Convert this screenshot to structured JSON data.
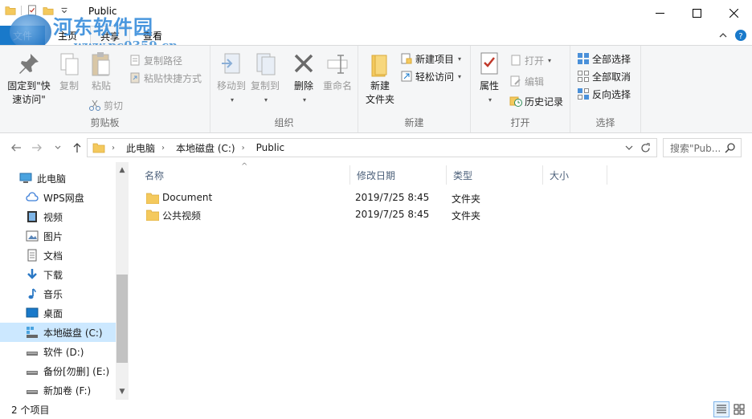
{
  "window": {
    "title": "Public"
  },
  "watermark": {
    "text": "河东软件园",
    "url": "www.pc0359.cn"
  },
  "tabs": [
    {
      "label": "文件"
    },
    {
      "label": "主页"
    },
    {
      "label": "共享"
    },
    {
      "label": "查看"
    }
  ],
  "ribbon": {
    "clipboard": {
      "label": "剪贴板",
      "pin": "固定到\"快",
      "pin2": "速访问\"",
      "copy": "复制",
      "paste": "粘贴",
      "copy_path": "复制路径",
      "paste_shortcut": "粘贴快捷方式",
      "cut": "剪切"
    },
    "organize": {
      "label": "组织",
      "move_to": "移动到",
      "copy_to": "复制到",
      "delete": "删除",
      "rename": "重命名"
    },
    "new": {
      "label": "新建",
      "new_folder_1": "新建",
      "new_folder_2": "文件夹",
      "new_item": "新建项目",
      "easy_access": "轻松访问"
    },
    "open": {
      "label": "打开",
      "properties": "属性",
      "open": "打开",
      "edit": "编辑",
      "history": "历史记录"
    },
    "select": {
      "label": "选择",
      "select_all": "全部选择",
      "select_none": "全部取消",
      "invert": "反向选择"
    }
  },
  "address": {
    "crumbs": [
      "此电脑",
      "本地磁盘 (C:)",
      "Public"
    ],
    "search_placeholder": "搜索\"Pub..."
  },
  "nav": [
    {
      "label": "此电脑",
      "icon": "computer-icon"
    },
    {
      "label": "WPS网盘",
      "icon": "cloud-icon"
    },
    {
      "label": "视频",
      "icon": "video-icon"
    },
    {
      "label": "图片",
      "icon": "picture-icon"
    },
    {
      "label": "文档",
      "icon": "document-icon"
    },
    {
      "label": "下载",
      "icon": "download-icon"
    },
    {
      "label": "音乐",
      "icon": "music-icon"
    },
    {
      "label": "桌面",
      "icon": "desktop-icon"
    },
    {
      "label": "本地磁盘 (C:)",
      "icon": "drive-c-icon",
      "selected": true
    },
    {
      "label": "软件 (D:)",
      "icon": "drive-icon"
    },
    {
      "label": "备份[勿删] (E:)",
      "icon": "drive-icon"
    },
    {
      "label": "新加卷 (F:)",
      "icon": "drive-icon"
    }
  ],
  "columns": {
    "name": "名称",
    "modified": "修改日期",
    "type": "类型",
    "size": "大小"
  },
  "files": [
    {
      "name": "Document",
      "modified": "2019/7/25 8:45",
      "type": "文件夹"
    },
    {
      "name": "公共视频",
      "modified": "2019/7/25 8:45",
      "type": "文件夹"
    }
  ],
  "status": {
    "count": "2 个项目"
  },
  "colors": {
    "accent": "#1979ca",
    "selected": "#cce8ff",
    "folder": "#f4c95d"
  }
}
